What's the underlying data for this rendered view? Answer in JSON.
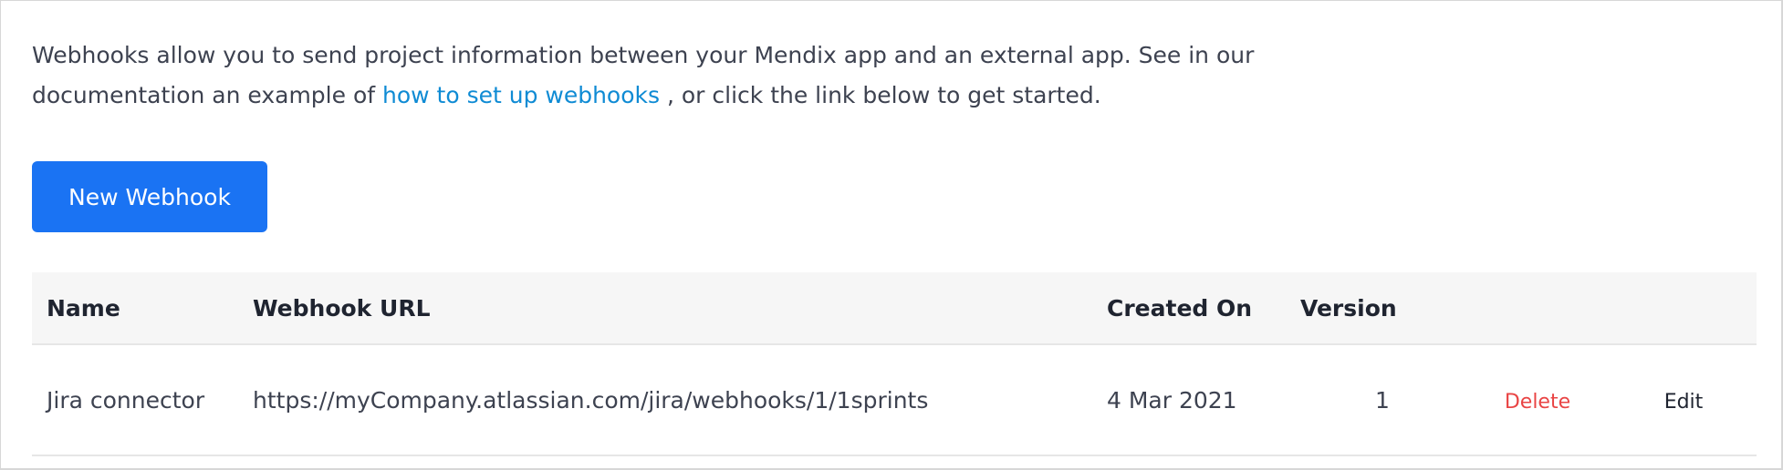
{
  "intro": {
    "text_before": "Webhooks allow you to send project information between your Mendix app and an external app. See in our documentation an example of ",
    "link_text": "how to set up webhooks",
    "text_after": " , or click the link below to get started."
  },
  "toolbar": {
    "new_webhook_label": "New Webhook"
  },
  "table": {
    "columns": [
      "Name",
      "Webhook URL",
      "Created On",
      "Version"
    ],
    "rows": [
      {
        "name": "Jira connector",
        "url": "https://myCompany.atlassian.com/jira/webhooks/1/1sprints",
        "created_on": "4 Mar 2021",
        "version": "1",
        "delete_label": "Delete",
        "edit_label": "Edit"
      }
    ]
  },
  "colors": {
    "primary_button": "#1a73f3",
    "link": "#0f8bd4",
    "delete": "#e94545"
  }
}
